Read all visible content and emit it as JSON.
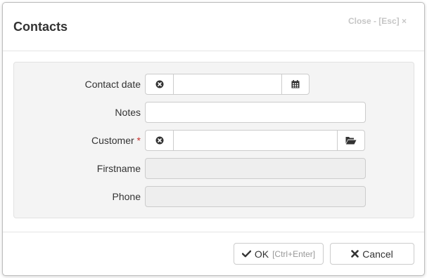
{
  "dialog": {
    "title": "Contacts",
    "close_label": "Close - [Esc] ×"
  },
  "form": {
    "contact_date": {
      "label": "Contact date",
      "value": ""
    },
    "notes": {
      "label": "Notes",
      "value": ""
    },
    "customer": {
      "label": "Customer",
      "required_mark": "*",
      "value": ""
    },
    "firstname": {
      "label": "Firstname",
      "value": ""
    },
    "phone": {
      "label": "Phone",
      "value": ""
    }
  },
  "footer": {
    "ok_label": "OK",
    "ok_hint": "[Ctrl+Enter]",
    "cancel_label": "Cancel"
  },
  "icons": {
    "clear": "times-circle-icon",
    "calendar": "calendar-icon",
    "folder": "folder-open-icon",
    "check": "check-icon",
    "cancel": "times-icon"
  }
}
